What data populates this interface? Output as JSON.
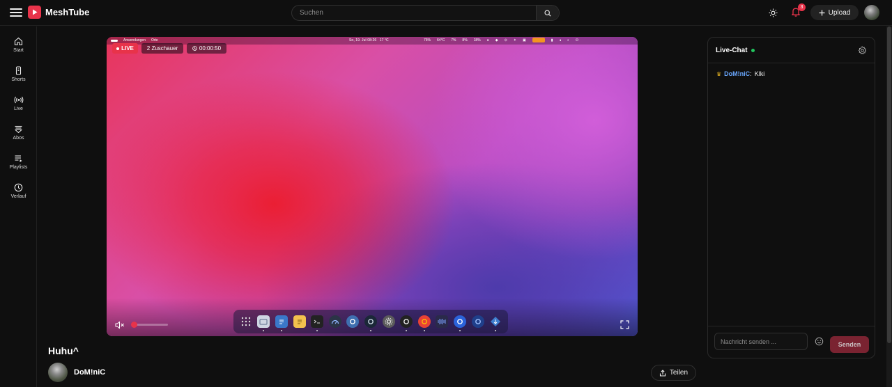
{
  "header": {
    "app_name": "MeshTube",
    "search_placeholder": "Suchen",
    "notification_count": "3",
    "upload_label": "Upload"
  },
  "sidebar": {
    "items": [
      {
        "label": "Start",
        "icon": "home-icon"
      },
      {
        "label": "Shorts",
        "icon": "shorts-icon"
      },
      {
        "label": "Live",
        "icon": "live-icon"
      },
      {
        "label": "Abos",
        "icon": "subscriptions-icon"
      },
      {
        "label": "Playlists",
        "icon": "playlist-icon"
      },
      {
        "label": "Verlauf",
        "icon": "history-icon"
      }
    ]
  },
  "player": {
    "live_label": "LIVE",
    "viewers": "2 Zuschauer",
    "elapsed": "00:00:50",
    "volume_level": 0.05,
    "muted": true,
    "screen": {
      "menubar_left": [
        "Anwendungen",
        "Orte"
      ],
      "menubar_clock": "So, 19. Jul  08:26",
      "menubar_weather": "17 °C",
      "menubar_stats": [
        "76%",
        "64°C",
        "7%",
        "8%",
        "18%"
      ],
      "dock_apps": [
        "launcher-icon",
        "finder-icon",
        "files-icon",
        "notes-icon",
        "terminal-icon",
        "dashboard-icon",
        "proton-icon",
        "steam-icon",
        "settings-icon",
        "obs-icon",
        "chrome-icon",
        "audio-icon",
        "signal-icon",
        "browser-icon",
        "git-icon"
      ]
    }
  },
  "video": {
    "title": "Huhu^",
    "channel": "DoM!niC",
    "share_label": "Teilen"
  },
  "chat": {
    "title": "Live-Chat",
    "messages": [
      {
        "user": "DoM!niC",
        "text": "Klki",
        "badge": "crown-icon"
      }
    ],
    "input_placeholder": "Nachricht senden ...",
    "send_label": "Senden"
  },
  "colors": {
    "accent": "#e8334a",
    "background": "#0f0f0f",
    "online": "#22c55e",
    "chat_user": "#6aa8ff"
  }
}
